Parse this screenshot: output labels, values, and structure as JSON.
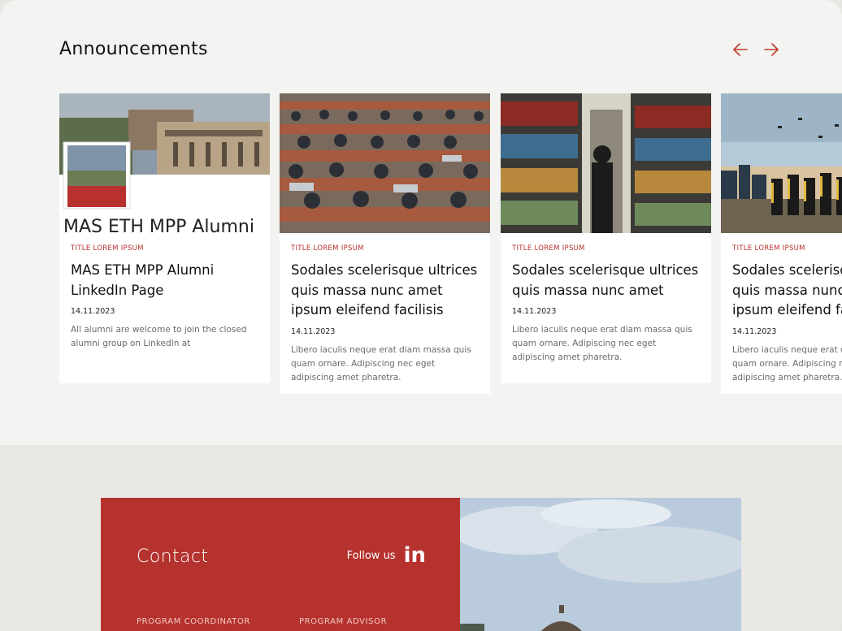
{
  "announcements": {
    "title": "Announcements",
    "prev_icon": "arrow-left-icon",
    "next_icon": "arrow-right-icon",
    "accent": "#b8312e",
    "cards": [
      {
        "image_overlay_text": "MAS ETH MPP Alumni",
        "kicker": "TITLE LOREM IPSUM",
        "title": "MAS ETH MPP Alumni LinkedIn Page",
        "date": "14.11.2023",
        "text": "All alumni are welcome to join the closed alumni group on LinkedIn at"
      },
      {
        "kicker": "TITLE LOREM IPSUM",
        "title": "Sodales scelerisque ultrices quis massa nunc amet ipsum eleifend facilisis",
        "date": "14.11.2023",
        "text": "Libero iaculis neque erat diam massa quis quam ornare. Adipiscing nec eget adipiscing amet pharetra."
      },
      {
        "kicker": "TITLE LOREM IPSUM",
        "title": "Sodales scelerisque ultrices quis massa nunc amet",
        "date": "14.11.2023",
        "text": "Libero iaculis neque erat diam massa quis quam ornare. Adipiscing nec eget adipiscing amet pharetra."
      },
      {
        "kicker": "TITLE LOREM IPSUM",
        "title": "Sodales scelerisque ultrices quis massa nunc amet ipsum eleifend facilisis",
        "date": "14.11.2023",
        "text": "Libero iaculis neque erat diam massa quis quam ornare. Adipiscing nec eget adipiscing amet pharetra."
      }
    ]
  },
  "contact": {
    "title": "Contact",
    "follow_label": "Follow us",
    "follow_icon": "linkedin-icon",
    "linkedin_glyph": "in",
    "roles": [
      "PROGRAM COORDINATOR",
      "PROGRAM ADVISOR"
    ],
    "brand_color": "#b5322e"
  }
}
